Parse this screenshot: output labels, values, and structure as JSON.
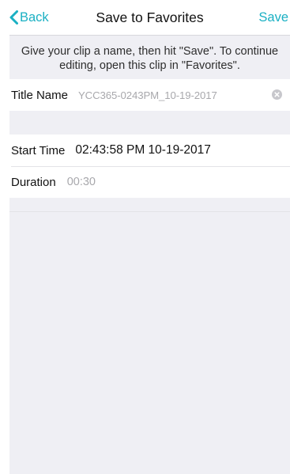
{
  "nav": {
    "back_label": "Back",
    "title": "Save to Favorites",
    "save_label": "Save"
  },
  "instructions": "Give your clip a name, then hit \"Save\". To continue editing, open this clip in \"Favorites\".",
  "fields": {
    "title_name": {
      "label": "Title Name",
      "value": "YCC365-0243PM_10-19-2017"
    },
    "start_time": {
      "label": "Start Time",
      "value": "02:43:58 PM 10-19-2017"
    },
    "duration": {
      "label": "Duration",
      "value": "00:30"
    }
  },
  "icons": {
    "back": "chevron-left-icon",
    "clear": "clear-circle-icon"
  },
  "colors": {
    "accent": "#1ab0c3",
    "background": "#efeff4",
    "placeholder_text": "#a8a8ac"
  }
}
